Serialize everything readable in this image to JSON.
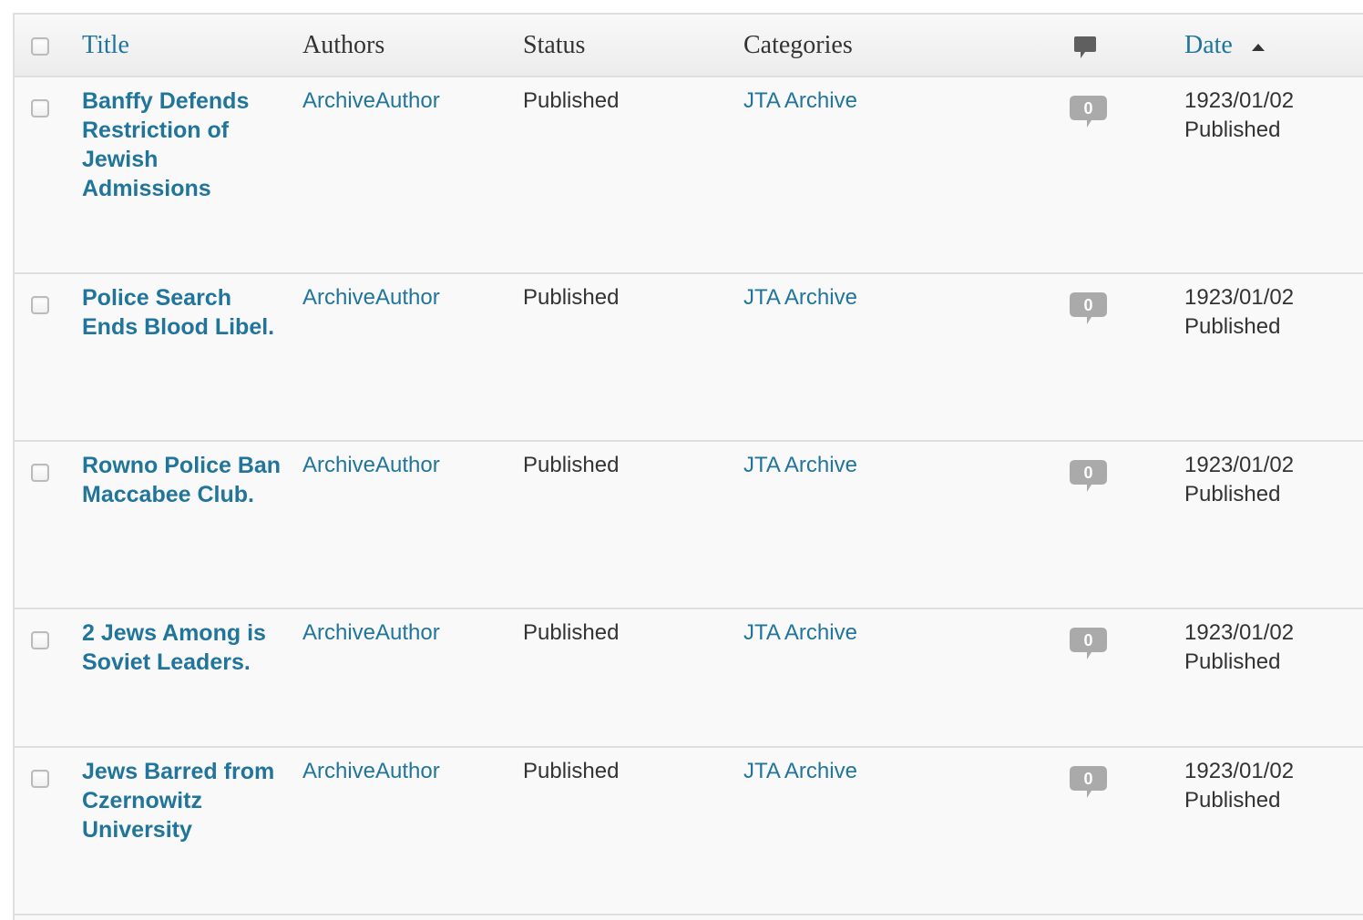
{
  "table": {
    "headers": {
      "title": "Title",
      "authors": "Authors",
      "status": "Status",
      "categories": "Categories",
      "comments_icon": "comment-icon",
      "date": "Date"
    },
    "sort": {
      "column": "Date",
      "direction": "ascending"
    },
    "rows": [
      {
        "title": "Banffy Defends Restriction of Jewish Admissions",
        "author": "ArchiveAuthor",
        "status": "Published",
        "category": "JTA Archive",
        "comments": "0",
        "date": "1923/01/02",
        "date_status": "Published"
      },
      {
        "title": "Police Search Ends Blood Libel.",
        "author": "ArchiveAuthor",
        "status": "Published",
        "category": "JTA Archive",
        "comments": "0",
        "date": "1923/01/02",
        "date_status": "Published"
      },
      {
        "title": "Rowno Police Ban Maccabee Club.",
        "author": "ArchiveAuthor",
        "status": "Published",
        "category": "JTA Archive",
        "comments": "0",
        "date": "1923/01/02",
        "date_status": "Published"
      },
      {
        "title": "2 Jews Among is Soviet Leaders.",
        "author": "ArchiveAuthor",
        "status": "Published",
        "category": "JTA Archive",
        "comments": "0",
        "date": "1923/01/02",
        "date_status": "Published"
      },
      {
        "title": "Jews Barred from Czernowitz University",
        "author": "ArchiveAuthor",
        "status": "Published",
        "category": "JTA Archive",
        "comments": "0",
        "date": "1923/01/02",
        "date_status": "Published"
      }
    ]
  },
  "colors": {
    "link": "#21759b",
    "text": "#333333",
    "row_background": "#f9f9f9",
    "border": "#dfdfdf",
    "comment_bubble": "#aaaaaa"
  }
}
